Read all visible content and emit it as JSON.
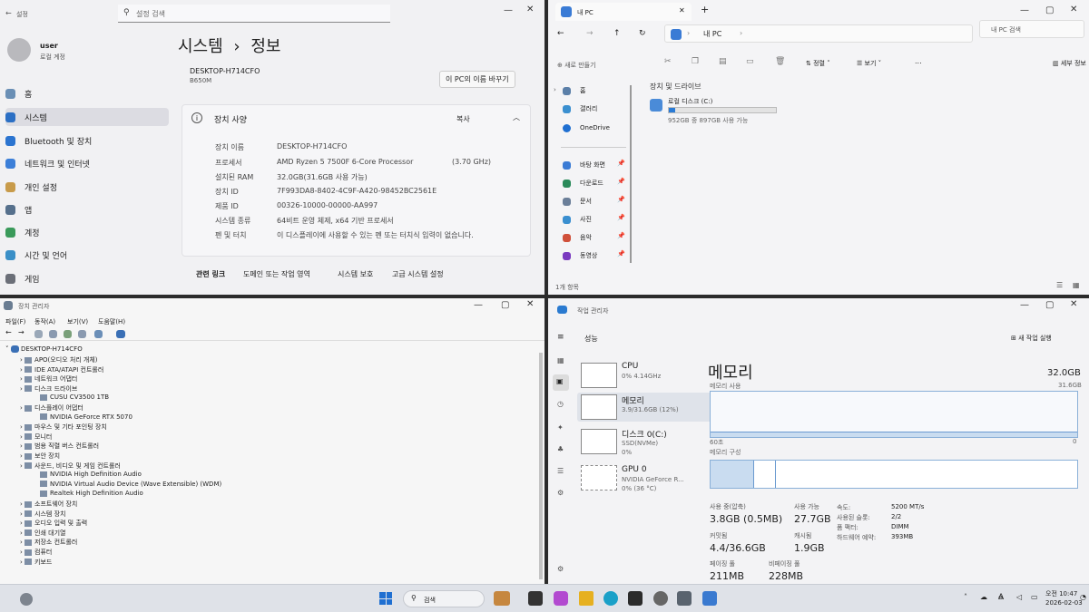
{
  "settings": {
    "app_title": "설정",
    "search_placeholder": "설정 검색",
    "user_name": "user",
    "user_type": "로컬 계정",
    "nav": [
      "홈",
      "시스템",
      "Bluetooth 및 장치",
      "네트워크 및 인터넷",
      "개인 설정",
      "앱",
      "계정",
      "시간 및 언어",
      "게임"
    ],
    "breadcrumb_parent": "시스템",
    "breadcrumb_sep": "›",
    "breadcrumb_current": "정보",
    "device_name": "DESKTOP-H714CFO",
    "device_model": "B650M",
    "rename_button": "이 PC의 이름 바꾸기",
    "spec_title": "장치 사양",
    "copy_button": "복사",
    "specs": [
      {
        "k": "장치 이름",
        "v": "DESKTOP-H714CFO"
      },
      {
        "k": "프로세서",
        "v": "AMD Ryzen 5 7500F 6-Core Processor"
      },
      {
        "k": "설치된 RAM",
        "v": "32.0GB(31.6GB 사용 가능)"
      },
      {
        "k": "장치 ID",
        "v": "7F993DA8-8402-4C9F-A420-98452BC2561E"
      },
      {
        "k": "제품 ID",
        "v": "00326-10000-00000-AA997"
      },
      {
        "k": "시스템 종류",
        "v": "64비트 운영 체제, x64 기반 프로세서"
      },
      {
        "k": "펜 및 터치",
        "v": "이 디스플레이에 사용할 수 있는 펜 또는 터치식 입력이 없습니다."
      }
    ],
    "cpu_speed": "(3.70 GHz)",
    "related_label": "관련 링크",
    "related_links": [
      "도메인 또는 작업 영역",
      "시스템 보호",
      "고급 시스템 설정"
    ]
  },
  "explorer": {
    "tab_title": "내 PC",
    "addr_path": "내 PC",
    "addr_sep": "›",
    "search_placeholder": "내 PC 검색",
    "new_label": "새로 만들기",
    "sort_label": "정렬",
    "view_label": "보기",
    "more_label": "...",
    "details_label": "세부 정보",
    "nav": [
      "홈",
      "갤러리",
      "OneDrive",
      "바탕 화면",
      "다운로드",
      "문서",
      "사진",
      "음악",
      "동영상"
    ],
    "section": "장치 및 드라이브",
    "drive_name": "로컬 디스크 (C:)",
    "drive_free": "952GB 중 897GB 사용 가능",
    "drive_usage": 0.06,
    "status": "1개 항목"
  },
  "devmgr": {
    "title": "장치 관리자",
    "menu": [
      "파일(F)",
      "동작(A)",
      "보기(V)",
      "도움말(H)"
    ],
    "root": "DESKTOP-H714CFO",
    "items": [
      {
        "label": "APO(오디오 처리 개체)",
        "indent": 1
      },
      {
        "label": "IDE ATA/ATAPI 컨트롤러",
        "indent": 1
      },
      {
        "label": "네트워크 어댑터",
        "indent": 1
      },
      {
        "label": "디스크 드라이브",
        "indent": 1
      },
      {
        "label": "CUSU CV3500 1TB",
        "indent": 2
      },
      {
        "label": "디스플레이 어댑터",
        "indent": 1
      },
      {
        "label": "NVIDIA GeForce RTX 5070",
        "indent": 2
      },
      {
        "label": "마우스 및 기타 포인팅 장치",
        "indent": 1
      },
      {
        "label": "모니터",
        "indent": 1
      },
      {
        "label": "범용 직렬 버스 컨트롤러",
        "indent": 1
      },
      {
        "label": "보안 장치",
        "indent": 1
      },
      {
        "label": "사운드, 비디오 및 게임 컨트롤러",
        "indent": 1
      },
      {
        "label": "NVIDIA High Definition Audio",
        "indent": 2
      },
      {
        "label": "NVIDIA Virtual Audio Device (Wave Extensible) (WDM)",
        "indent": 2
      },
      {
        "label": "Realtek High Definition Audio",
        "indent": 2
      },
      {
        "label": "소프트웨어 장치",
        "indent": 1
      },
      {
        "label": "시스템 장치",
        "indent": 1
      },
      {
        "label": "오디오 입력 및 출력",
        "indent": 1
      },
      {
        "label": "인쇄 대기열",
        "indent": 1
      },
      {
        "label": "저장소 컨트롤러",
        "indent": 1
      },
      {
        "label": "컴퓨터",
        "indent": 1
      },
      {
        "label": "키보드",
        "indent": 1
      }
    ]
  },
  "taskmgr": {
    "title": "작업 관리자",
    "page": "성능",
    "new_task": "새 작업 실행",
    "items": [
      {
        "name": "CPU",
        "sub": "0% 4.14GHz"
      },
      {
        "name": "메모리",
        "sub": "3.9/31.6GB (12%)"
      },
      {
        "name": "디스크 0(C:)",
        "sub": "SSD(NVMe)",
        "sub2": "0%"
      },
      {
        "name": "GPU 0",
        "sub": "NVIDIA GeForce R...",
        "sub2": "0% (36 °C)"
      }
    ],
    "heading": "메모리",
    "total": "32.0GB",
    "usage_label": "메모리 사용",
    "usage_max": "31.6GB",
    "axis_left": "60초",
    "axis_right": "0",
    "composition_label": "메모리 구성",
    "stats": [
      {
        "label": "사용 중(압축)",
        "value": "3.8GB (0.5MB)"
      },
      {
        "label": "사용 가능",
        "value": "27.7GB"
      },
      {
        "label": "커밋됨",
        "value": "4.4/36.6GB"
      },
      {
        "label": "캐시됨",
        "value": "1.9GB"
      },
      {
        "label": "페이징 풀",
        "value": "211MB"
      },
      {
        "label": "비페이징 풀",
        "value": "228MB"
      }
    ],
    "right_labels": [
      "속도:",
      "사용된 슬롯:",
      "폼 팩터:",
      "하드웨어 예약:"
    ],
    "right_values": [
      "5200 MT/s",
      "2/2",
      "DIMM",
      "393MB"
    ]
  },
  "taskbar": {
    "search": "검색",
    "time": "오전 10:47",
    "date": "2026-02-03",
    "lang": "A"
  }
}
